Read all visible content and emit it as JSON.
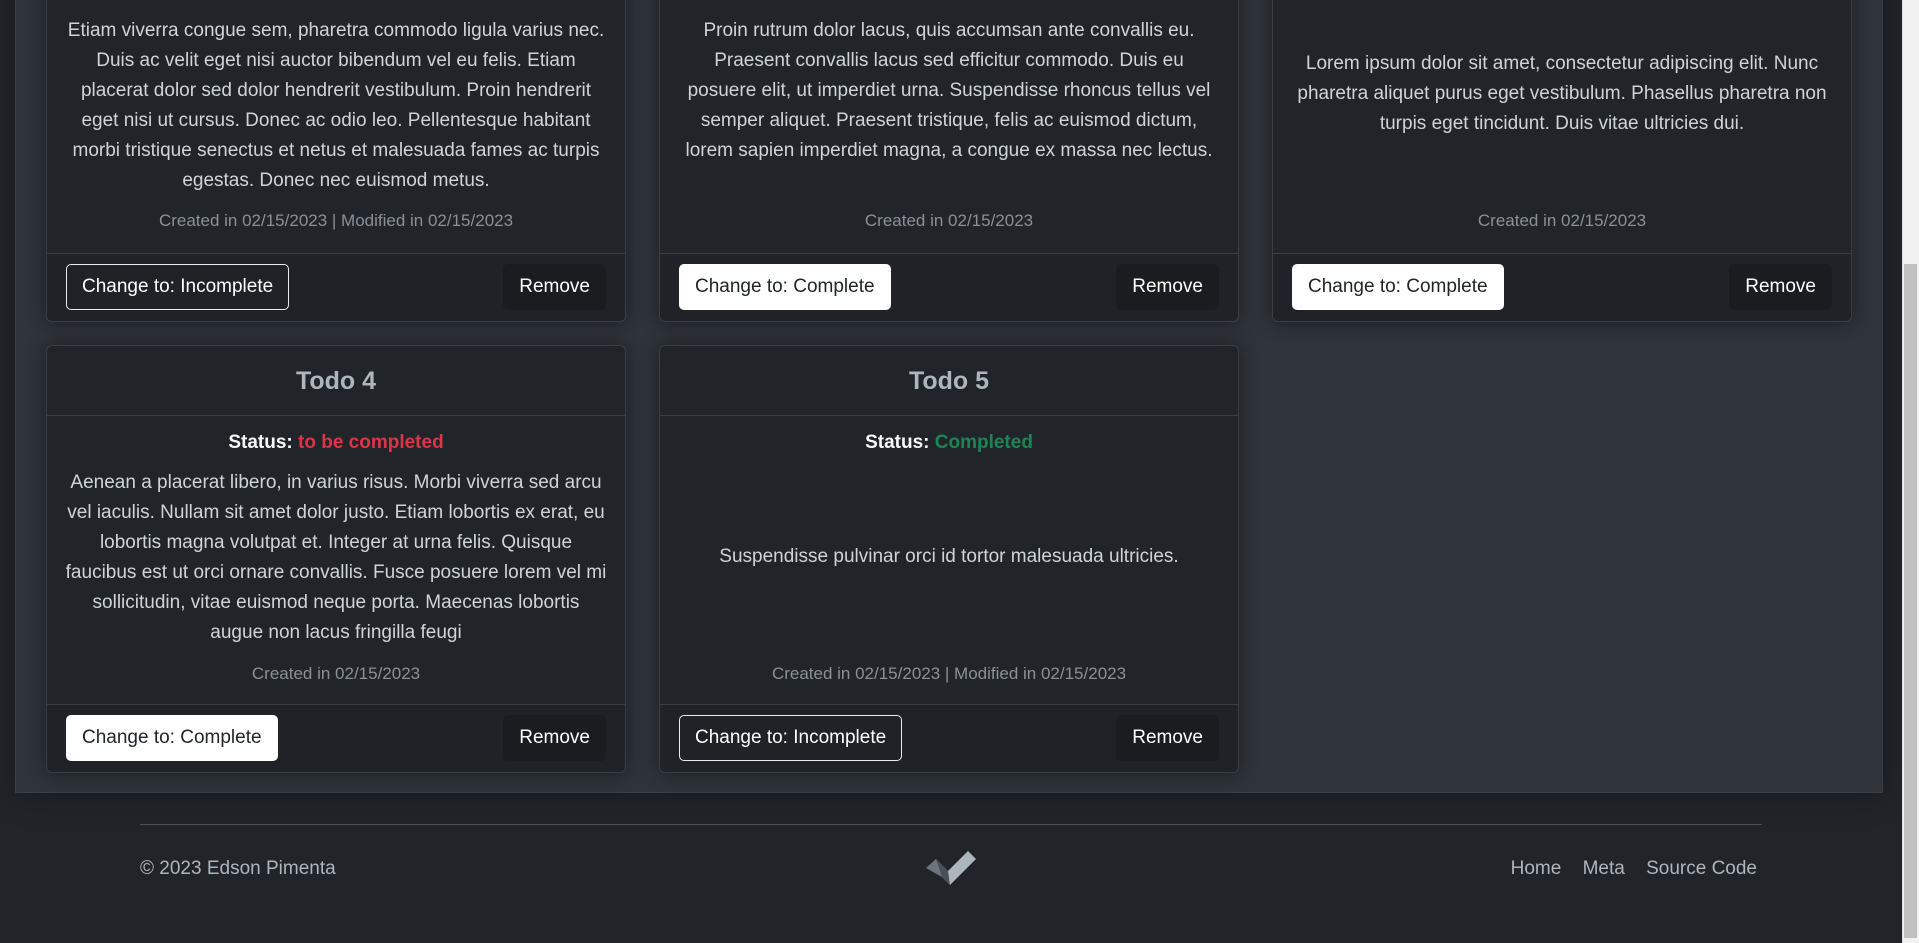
{
  "todos": [
    {
      "status_label": "",
      "status_value": "",
      "description": "Etiam viverra congue sem, pharetra commodo ligula varius nec. Duis ac velit eget nisi auctor bibendum vel eu felis. Etiam placerat dolor sed dolor hendrerit vestibulum. Proin hendrerit eget nisi ut cursus. Donec ac odio leo. Pellentesque habitant morbi tristique senectus et netus et malesuada fames ac turpis egestas. Donec nec euismod metus.",
      "dates": "Created in 02/15/2023 | Modified in 02/15/2023",
      "toggle_label": "Change to: Incomplete",
      "remove_label": "Remove"
    },
    {
      "status_label": "",
      "status_value": "",
      "description": "Proin rutrum dolor lacus, quis accumsan ante convallis eu. Praesent convallis lacus sed efficitur commodo. Duis eu posuere elit, ut imperdiet urna. Suspendisse rhoncus tellus vel semper aliquet. Praesent tristique, felis ac euismod dictum, lorem sapien imperdiet magna, a congue ex massa nec lectus.",
      "dates": "Created in 02/15/2023",
      "toggle_label": "Change to: Complete",
      "remove_label": "Remove"
    },
    {
      "status_label": "",
      "status_value": "",
      "description": "Lorem ipsum dolor sit amet, consectetur adipiscing elit. Nunc pharetra aliquet purus eget vestibulum. Phasellus pharetra non turpis eget tincidunt. Duis vitae ultricies dui.",
      "dates": "Created in 02/15/2023",
      "toggle_label": "Change to: Complete",
      "remove_label": "Remove"
    },
    {
      "title": "Todo 4",
      "status_label": "Status:",
      "status_value": "to be completed",
      "description": "Aenean a placerat libero, in varius risus. Morbi viverra sed arcu vel iaculis. Nullam sit amet dolor justo. Etiam lobortis ex erat, eu lobortis magna volutpat et. Integer at urna felis. Quisque faucibus est ut orci ornare convallis. Fusce posuere lorem vel mi sollicitudin, vitae euismod neque porta. Maecenas lobortis augue non lacus fringilla feugi",
      "dates": "Created in 02/15/2023",
      "toggle_label": "Change to: Complete",
      "remove_label": "Remove"
    },
    {
      "title": "Todo 5",
      "status_label": "Status:",
      "status_value": "Completed",
      "description": "Suspendisse pulvinar orci id tortor malesuada ultricies.",
      "dates": "Created in 02/15/2023 | Modified in 02/15/2023",
      "toggle_label": "Change to: Incomplete",
      "remove_label": "Remove"
    }
  ],
  "footer": {
    "copyright": "© 2023 Edson Pimenta",
    "nav": [
      "Home",
      "Meta",
      "Source Code"
    ],
    "logo_icon": "checkmark-logo-icon"
  },
  "colors": {
    "incomplete": "#dc3545",
    "complete": "#198754"
  }
}
